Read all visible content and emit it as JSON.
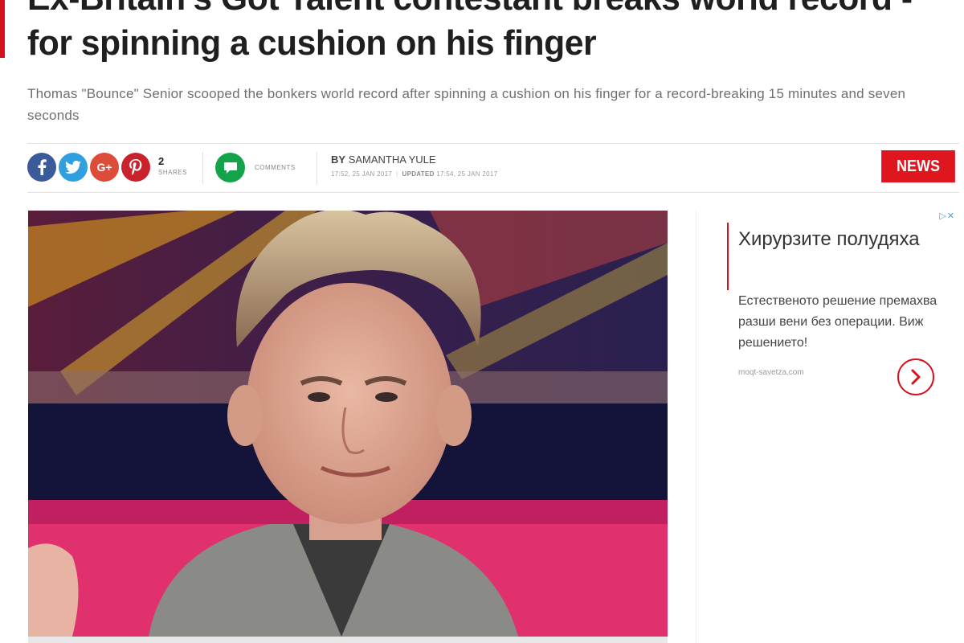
{
  "article": {
    "headline": "Ex-Britain's Got Talent contestant breaks world record - for spinning a cushion on his finger",
    "standfirst": "Thomas \"Bounce\" Senior scooped the bonkers world record after spinning a cushion on his finger for a record-breaking 15 minutes and seven seconds",
    "section_tag": "NEWS"
  },
  "share": {
    "count": "2",
    "count_label": "SHARES",
    "buttons": [
      {
        "icon": "facebook-icon",
        "color": "#3b5a9a"
      },
      {
        "icon": "twitter-icon",
        "color": "#2f9fe0"
      },
      {
        "icon": "google-plus-icon",
        "label": "G+",
        "color": "#dd4b39"
      },
      {
        "icon": "pinterest-icon",
        "color": "#c9222c"
      }
    ],
    "comments_label": "COMMENTS",
    "comments_color": "#13a44a"
  },
  "byline": {
    "prefix": "BY",
    "author": "SAMANTHA YULE",
    "published": "17:52, 25 JAN 2017",
    "updated_label": "UPDATED",
    "updated": "17:54, 25 JAN 2017"
  },
  "ad": {
    "title": "Хирурзите полудяха",
    "body": "Естественото решение премахва разши вени без операции. Виж решението!",
    "domain": "moqt-savetza.com",
    "marker": "▷✕"
  },
  "colors": {
    "accent_red": "#d6121e",
    "news_tag": "#e0161f"
  }
}
